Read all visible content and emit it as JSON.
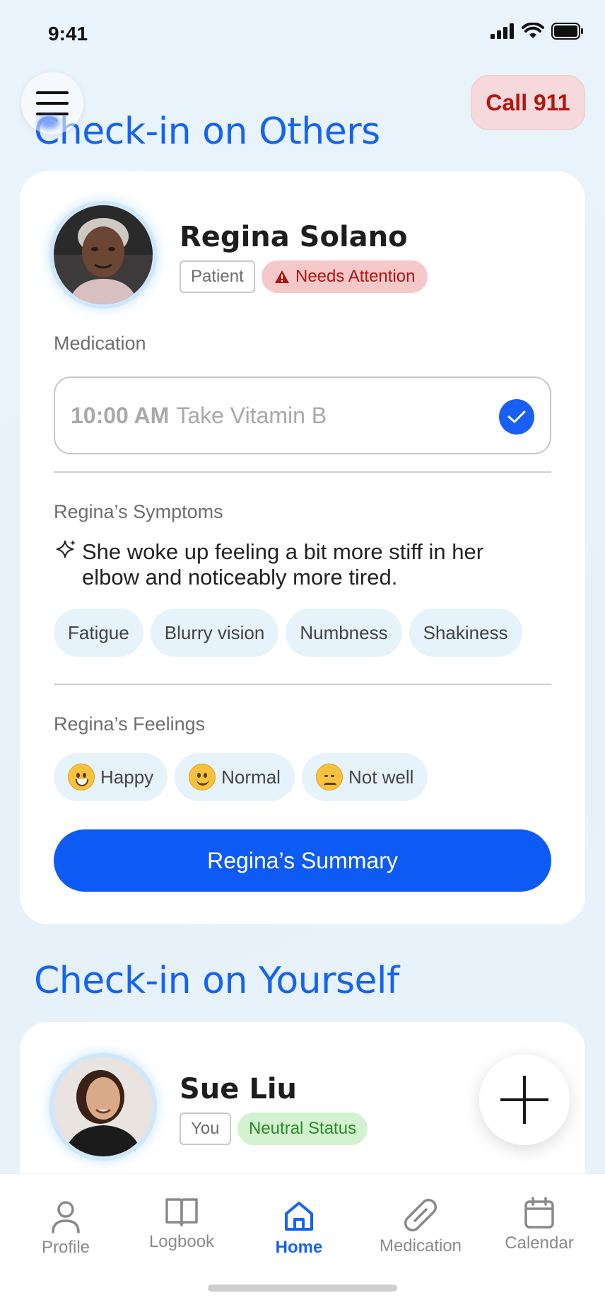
{
  "status_bar": {
    "time": "9:41"
  },
  "header": {
    "call_label": "Call 911"
  },
  "others_section": {
    "title": "Check-in on Others",
    "patient": {
      "name": "Regina Solano",
      "role_tag": "Patient",
      "status_tag": "Needs Attention"
    },
    "medication": {
      "label": "Medication",
      "time": "10:00 AM",
      "name": "Take Vitamin B",
      "completed": true
    },
    "symptoms": {
      "label": "Regina’s Symptoms",
      "note": "She woke up feeling a bit more stiff in her elbow and noticeably more tired.",
      "chips": [
        "Fatigue",
        "Blurry vision",
        "Numbness",
        "Shakiness"
      ]
    },
    "feelings": {
      "label": "Regina’s Feelings",
      "options": [
        {
          "label": "Happy",
          "icon": "grinning-face-icon"
        },
        {
          "label": "Normal",
          "icon": "slightly-smiling-face-icon"
        },
        {
          "label": "Not well",
          "icon": "pensive-face-icon"
        }
      ]
    },
    "summary_button": "Regina’s Summary"
  },
  "self_section": {
    "title": "Check-in on Yourself",
    "person": {
      "name": "Sue Liu",
      "role_tag": "You",
      "status_tag": "Neutral Status"
    }
  },
  "tabs": [
    {
      "label": "Profile",
      "icon": "person-icon",
      "active": false
    },
    {
      "label": "Logbook",
      "icon": "book-icon",
      "active": false
    },
    {
      "label": "Home",
      "icon": "home-icon",
      "active": true
    },
    {
      "label": "Medication",
      "icon": "pill-icon",
      "active": false
    },
    {
      "label": "Calendar",
      "icon": "calendar-icon",
      "active": false
    }
  ],
  "colors": {
    "accent": "#1563f5",
    "alert_bg": "#f5c9c9",
    "alert_text": "#b3150f",
    "neutral_bg": "#d3f2cf",
    "neutral_text": "#2a8a2a",
    "chip_bg": "#e7f3fb"
  }
}
